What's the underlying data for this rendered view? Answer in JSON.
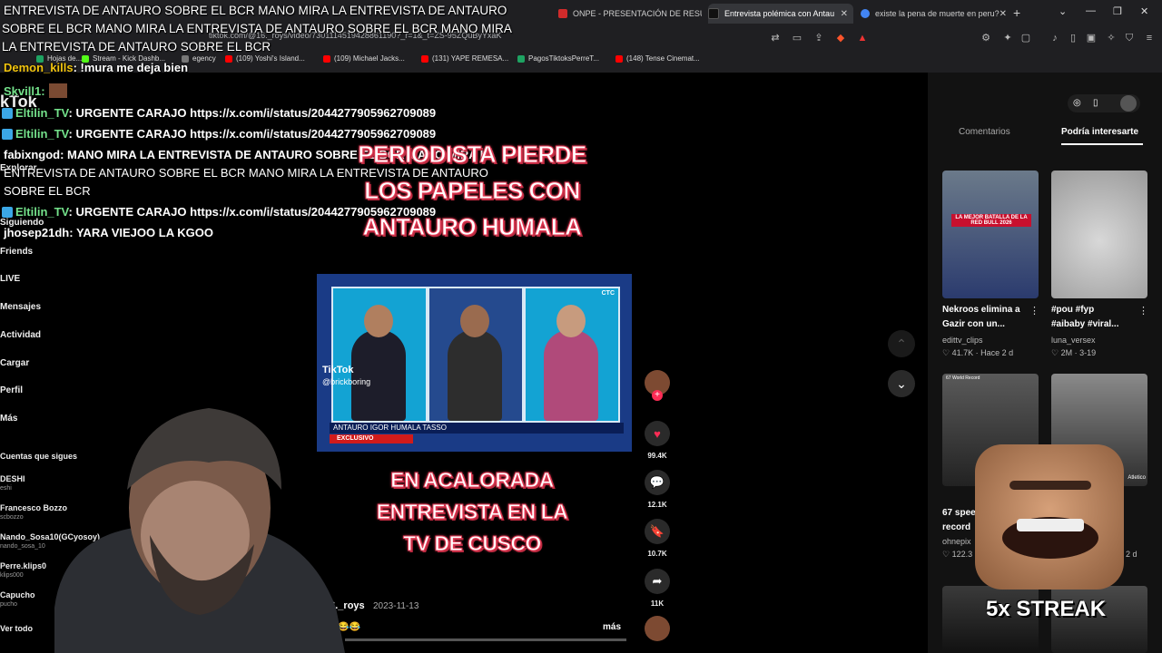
{
  "browser": {
    "tabs": [
      {
        "label": "ONPE - PRESENTACIÓN DE RESULT",
        "fav": "#d12b2b",
        "active": false
      },
      {
        "label": "Entrevista polémica con Antau",
        "fav": "#111",
        "active": true
      },
      {
        "label": "existe la pena de muerte en peru?",
        "fav": "#4285f4",
        "active": false
      }
    ],
    "url": "tiktok.com/@16._roys/video/7301114519428861190?_r=1&_t=ZS-95ZQuByYxaK",
    "bookmarks": [
      {
        "label": "Hojas de...",
        "color": "#1ea362"
      },
      {
        "label": "Stream - Kick Dashb...",
        "color": "#53fc18"
      },
      {
        "label": "egency",
        "color": "#777"
      },
      {
        "label": "(109) Yoshi's Island...",
        "color": "#ff0000"
      },
      {
        "label": "(109) Michael Jacks...",
        "color": "#ff0000"
      },
      {
        "label": "(131) YAPE REMESA...",
        "color": "#ff0000"
      },
      {
        "label": "PagosTiktoksPerreT...",
        "color": "#1ea362"
      },
      {
        "label": "(148) Tense Cinemat...",
        "color": "#ff0000"
      }
    ]
  },
  "overlay": {
    "banner_lines": [
      "ENTREVISTA DE ANTAURO SOBRE EL BCR MANO MIRA LA ENTREVISTA DE ANTAURO",
      "SOBRE EL BCR MANO MIRA LA ENTREVISTA DE ANTAURO SOBRE EL BCR MANO MIRA",
      "LA ENTREVISTA DE ANTAURO SOBRE EL BCR"
    ],
    "chat": [
      {
        "user": "Demon_kills",
        "text": "!mura me deja bien"
      },
      {
        "user": "Skvill1:",
        "text": ""
      },
      {
        "user": "Eltilin_TV",
        "text": ": URGENTE CARAJO https://x.com/i/status/2044277905962709089"
      },
      {
        "user": "Eltilin_TV",
        "text": ": URGENTE CARAJO https://x.com/i/status/2044277905962709089"
      },
      {
        "user": "fabixngod",
        "text": ": MANO MIRA LA ENTREVISTA DE ANTAURO SOBRE EL BCR MANO MIRA LA"
      },
      {
        "user": "",
        "text": "ENTREVISTA DE ANTAURO SOBRE EL BCR MANO MIRA LA ENTREVISTA DE ANTAURO"
      },
      {
        "user": "",
        "text": "SOBRE EL BCR"
      },
      {
        "user": "Eltilin_TV",
        "text": ": URGENTE CARAJO https://x.com/i/status/2044277905962709089"
      },
      {
        "user": "jhosep21dh",
        "text": ": YARA VIEJOO LA KGOO"
      }
    ],
    "streak": "5x STREAK"
  },
  "sidebar": {
    "logo": "kTok",
    "items": [
      "Explorar",
      "Siguiendo",
      "Friends",
      "LIVE",
      "Mensajes",
      "Actividad",
      "Cargar",
      "Perfil",
      "Más"
    ],
    "following_header": "Cuentas que sigues",
    "following": [
      {
        "name": "DESHI",
        "handle": "eshi"
      },
      {
        "name": "Francesco Bozzo",
        "handle": "scbozzo"
      },
      {
        "name": "Nando_Sosa10(GCyosoy)",
        "handle": "nando_sosa_10"
      },
      {
        "name": "Perre.klips0",
        "handle": "klips000"
      },
      {
        "name": "Capucho",
        "handle": "pucho"
      }
    ],
    "see_all": "Ver todo"
  },
  "video": {
    "caption_top": [
      "PERIODISTA PIERDE",
      "LOS PAPELES CON",
      "ANTAURO HUMALA"
    ],
    "caption_bottom": [
      "EN ACALORADA",
      "ENTREVISTA EN LA",
      "TV DE CUSCO"
    ],
    "watermark": "TikTok",
    "watermark_handle": "@brickboring",
    "lower_third": "ANTAURO IGOR HUMALA TASSO",
    "exclusive": "EXCLUSIVO",
    "channel_logo": "CTC",
    "author": "16._roys",
    "date": "2023-11-13",
    "more": "más"
  },
  "actions": {
    "likes": "99.4K",
    "comments": "12.1K",
    "saves": "10.7K",
    "shares": "11K"
  },
  "right_panel": {
    "tabs": [
      "Comentarios",
      "Podría interesarte"
    ],
    "items": [
      {
        "title": "Nekroos elimina a",
        "title2": "Gazir con un...",
        "user": "edittv_clips",
        "likes": "41.7K",
        "time": "Hace 2 d",
        "thumb_text": "LA MEJOR BATALLA DE LA RED BULL 2026"
      },
      {
        "title": "#pou #fyp",
        "title2": "#aibaby #viral...",
        "user": "luna_versex",
        "likes": "2M",
        "time": "3-19",
        "thumb_text": ""
      },
      {
        "title": "67 spee",
        "title2": "record",
        "user": "ohnepix",
        "likes": "122.3",
        "time": "",
        "thumb_text": "67 World Record"
      },
      {
        "title": "",
        "title2": "",
        "user": "",
        "likes": "",
        "time": "2 d",
        "thumb_text": "Atletico"
      }
    ]
  }
}
